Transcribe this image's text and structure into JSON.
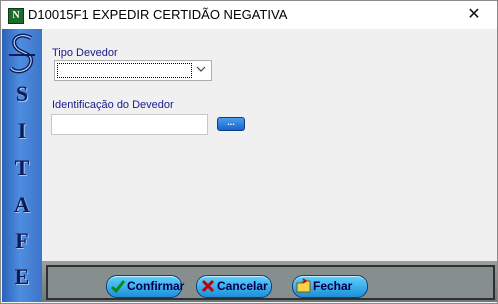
{
  "window": {
    "title": "D10015F1 EXPEDIR CERTIDÃO NEGATIVA",
    "app_icon_letter": "N",
    "close_glyph": "✕"
  },
  "sidebar": {
    "letters": [
      "S",
      "I",
      "T",
      "A",
      "F",
      "E"
    ],
    "logo_icon": "sitafe-logo-icon"
  },
  "form": {
    "tipo_devedor_label": "Tipo Devedor",
    "tipo_devedor_value": "",
    "identificacao_label": "Identificação do Devedor",
    "identificacao_value": "",
    "lookup_button_label": "..."
  },
  "buttons": {
    "confirmar": "Confirmar",
    "cancelar": "Cancelar",
    "fechar": "Fechar"
  },
  "colors": {
    "label_text": "#1a1a8c",
    "sidebar_blue": "#3d74c9",
    "button_blue": "#1e8fd8"
  }
}
